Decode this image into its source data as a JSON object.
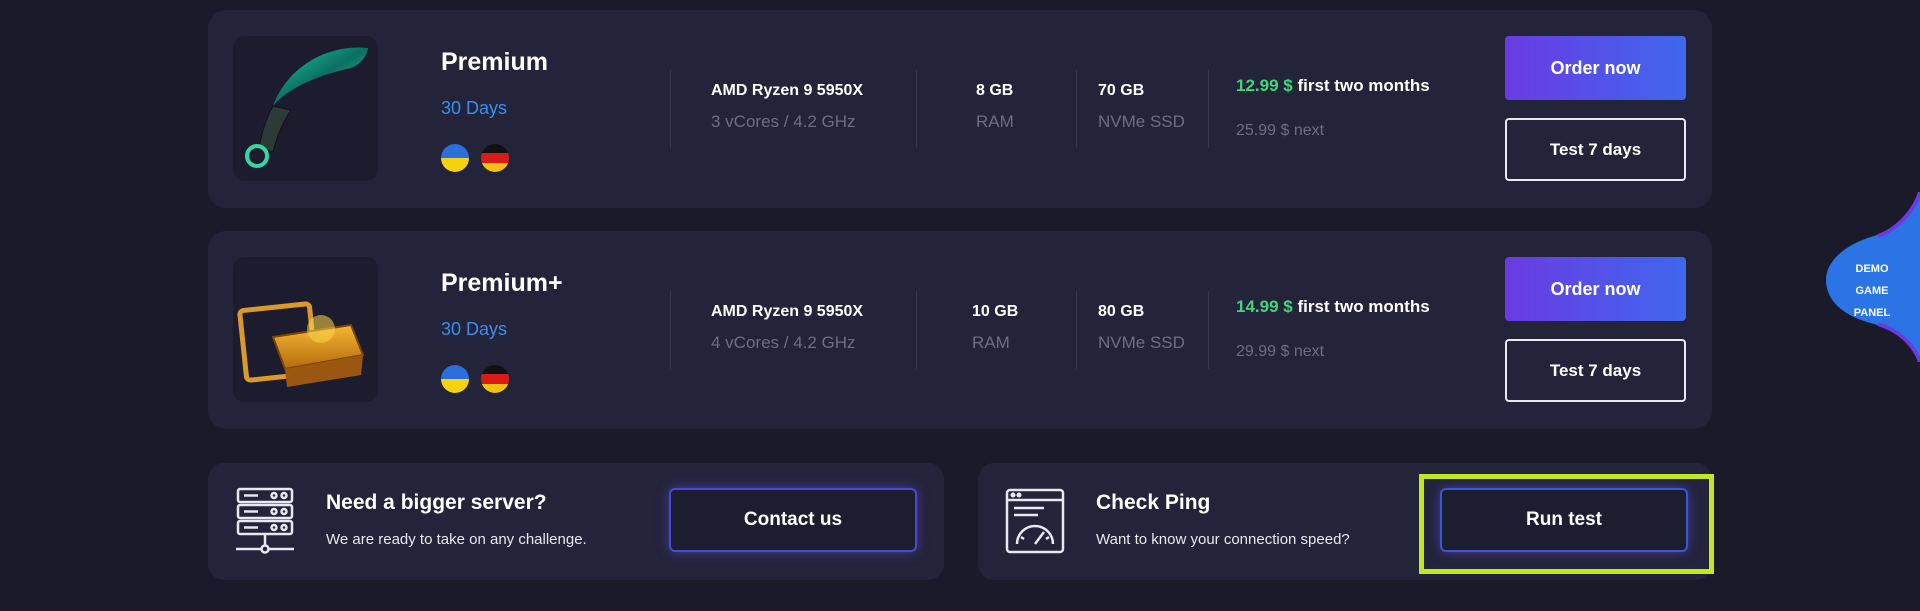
{
  "plans": [
    {
      "name": "Premium",
      "duration": "30 Days",
      "thumbnail_icon": "karambit-knife-icon",
      "cpu": {
        "value": "AMD Ryzen 9 5950X",
        "detail": "3 vCores / 4.2 GHz"
      },
      "ram": {
        "value": "8 GB",
        "label": "RAM"
      },
      "disk": {
        "value": "70 GB",
        "label": "NVMe SSD"
      },
      "price": {
        "amount": "12.99 $",
        "text": "first two months",
        "next": "25.99 $ next"
      },
      "order_label": "Order now",
      "test_label": "Test 7 days"
    },
    {
      "name": "Premium+",
      "duration": "30 Days",
      "thumbnail_icon": "gold-case-icon",
      "cpu": {
        "value": "AMD Ryzen 9 5950X",
        "detail": "4 vCores / 4.2 GHz"
      },
      "ram": {
        "value": "10 GB",
        "label": "RAM"
      },
      "disk": {
        "value": "80 GB",
        "label": "NVMe SSD"
      },
      "price": {
        "amount": "14.99 $",
        "text": "first two months",
        "next": "29.99 $ next"
      },
      "order_label": "Order now",
      "test_label": "Test 7 days"
    }
  ],
  "bigger_server": {
    "title": "Need a bigger server?",
    "subtitle": "We are ready to take on any challenge.",
    "button": "Contact us",
    "icon": "server-rack-icon"
  },
  "check_ping": {
    "title": "Check Ping",
    "subtitle": "Want to know your connection speed?",
    "button": "Run test",
    "icon": "speedometer-icon"
  },
  "demo_panel": {
    "lines": [
      "DEMO",
      "GAME",
      "PANEL"
    ]
  },
  "colors": {
    "background": "#1a1a2b",
    "card": "#23233a",
    "accent_blue": "#3a8ef0",
    "price_green": "#3fd879",
    "order_gradient_start": "#6a3be3",
    "order_gradient_end": "#3f67ee",
    "highlight": "#c2e81e"
  },
  "flags": [
    "ukraine-flag-icon",
    "germany-flag-icon"
  ]
}
